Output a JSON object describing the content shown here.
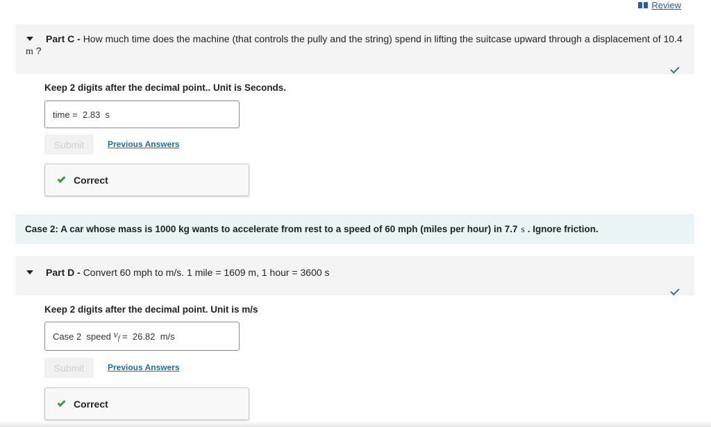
{
  "review": {
    "label": "Review"
  },
  "part_c": {
    "name": "Part C -",
    "question": "How much time does the machine (that controls the pully and the string) spend in lifting the suitcase upward through a displacement of",
    "value": "10.4",
    "unit": "m",
    "suffix": "?",
    "instruction": "Keep 2 digits after the decimal point.. Unit is Seconds.",
    "answer_label": "time =",
    "answer_value": "2.83",
    "answer_unit": "s",
    "submit_label": "Submit",
    "previous_answers_label": "Previous Answers",
    "feedback": "Correct"
  },
  "case2": {
    "text_before": "Case 2: A car whose mass is 1000 kg wants to accelerate from rest to a speed of 60 mph (miles per hour) in 7.7",
    "unit": "s",
    "text_after": ". Ignore friction."
  },
  "part_d": {
    "name": "Part D -",
    "question": "Convert 60 mph to m/s. 1 mile = 1609 m, 1 hour = 3600 s",
    "instruction": "Keep 2 digits after the decimal point. Unit is m/s",
    "answer_prefix": "Case 2  speed",
    "answer_var": "v",
    "answer_sub": "f",
    "answer_eq": "=",
    "answer_value": "26.82",
    "answer_unit": "m/s",
    "submit_label": "Submit",
    "previous_answers_label": "Previous Answers",
    "feedback": "Correct"
  },
  "colors": {
    "link": "#1f6fa3",
    "check_blue": "#2a72b5",
    "check_green": "#3a9a3a",
    "banner_bg": "#e8f4f6"
  }
}
